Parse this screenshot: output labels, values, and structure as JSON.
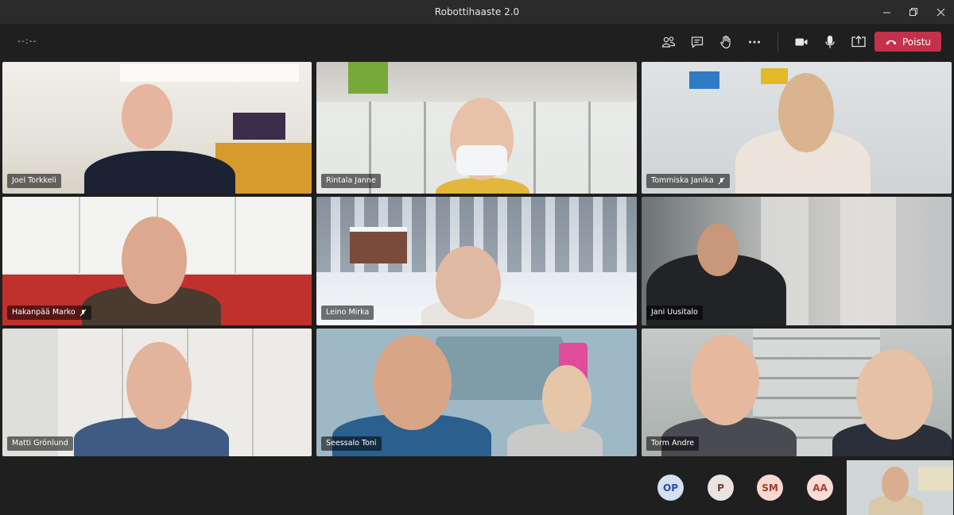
{
  "window": {
    "title": "Robottihaaste 2.0",
    "controls": [
      "minimize-icon",
      "restore-icon",
      "close-icon"
    ]
  },
  "toolbar": {
    "timer": "--:--",
    "icons": [
      "participants-icon",
      "chat-icon",
      "raise-hand-icon",
      "more-icon",
      "camera-icon",
      "microphone-icon",
      "share-screen-icon"
    ],
    "leave_label": "Poistu",
    "leave_color": "#c4314b"
  },
  "participants": [
    {
      "name": "Joel Torkkeli",
      "muted": false
    },
    {
      "name": "Rintala Janne",
      "muted": false
    },
    {
      "name": "Tommiska Janika",
      "muted": true
    },
    {
      "name": "Hakanpää Marko",
      "muted": true
    },
    {
      "name": "Leino Mirka",
      "muted": false
    },
    {
      "name": "Jani Uusitalo",
      "muted": false
    },
    {
      "name": "Matti Grönlund",
      "muted": false
    },
    {
      "name": "Seessalo Toni",
      "muted": false
    },
    {
      "name": "Torm Andre",
      "muted": false
    }
  ],
  "overflow_avatars": [
    {
      "initials": "OP",
      "color": "#d3dff2",
      "text_color": "#2a4f9c"
    },
    {
      "initials": "P",
      "color": "#ebe3df",
      "text_color": "#6a3e34"
    },
    {
      "initials": "SM",
      "color": "#f6d8d1",
      "text_color": "#a13a24"
    },
    {
      "initials": "AA",
      "color": "#f8dcd6",
      "text_color": "#a8402c"
    }
  ]
}
